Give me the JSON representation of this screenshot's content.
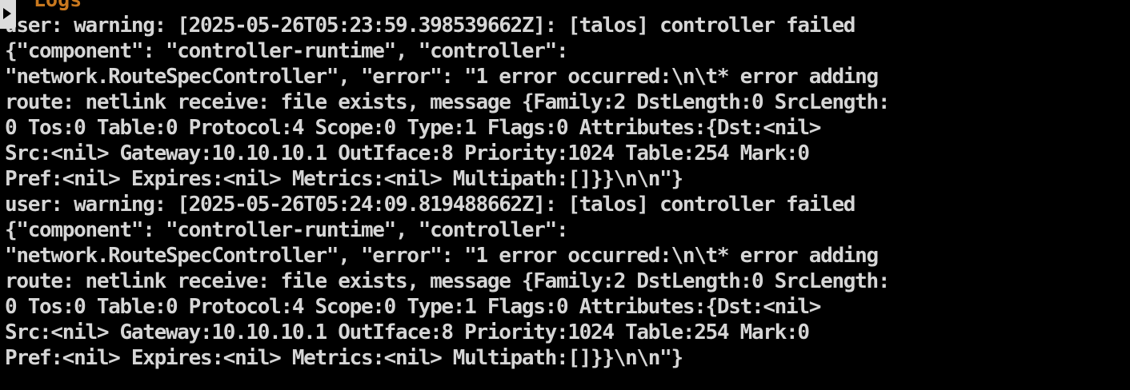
{
  "panel": {
    "title": "Logs"
  },
  "colors": {
    "background": "#000000",
    "text": "#d6d6d6",
    "title": "#c8781e"
  },
  "icons": {
    "corner": "play-arrow-icon"
  },
  "log_lines": [
    "user: warning: [2025-05-26T05:23:59.398539662Z]: [talos] controller failed",
    "{\"component\": \"controller-runtime\", \"controller\":",
    "\"network.RouteSpecController\", \"error\": \"1 error occurred:\\n\\t* error adding",
    "route: netlink receive: file exists, message {Family:2 DstLength:0 SrcLength:",
    "0 Tos:0 Table:0 Protocol:4 Scope:0 Type:1 Flags:0 Attributes:{Dst:<nil>",
    "Src:<nil> Gateway:10.10.10.1 OutIface:8 Priority:1024 Table:254 Mark:0",
    "Pref:<nil> Expires:<nil> Metrics:<nil> Multipath:[]}}\\n\\n\"}",
    "user: warning: [2025-05-26T05:24:09.819488662Z]: [talos] controller failed",
    "{\"component\": \"controller-runtime\", \"controller\":",
    "\"network.RouteSpecController\", \"error\": \"1 error occurred:\\n\\t* error adding",
    "route: netlink receive: file exists, message {Family:2 DstLength:0 SrcLength:",
    "0 Tos:0 Table:0 Protocol:4 Scope:0 Type:1 Flags:0 Attributes:{Dst:<nil>",
    "Src:<nil> Gateway:10.10.10.1 OutIface:8 Priority:1024 Table:254 Mark:0",
    "Pref:<nil> Expires:<nil> Metrics:<nil> Multipath:[]}}\\n\\n\"}"
  ]
}
